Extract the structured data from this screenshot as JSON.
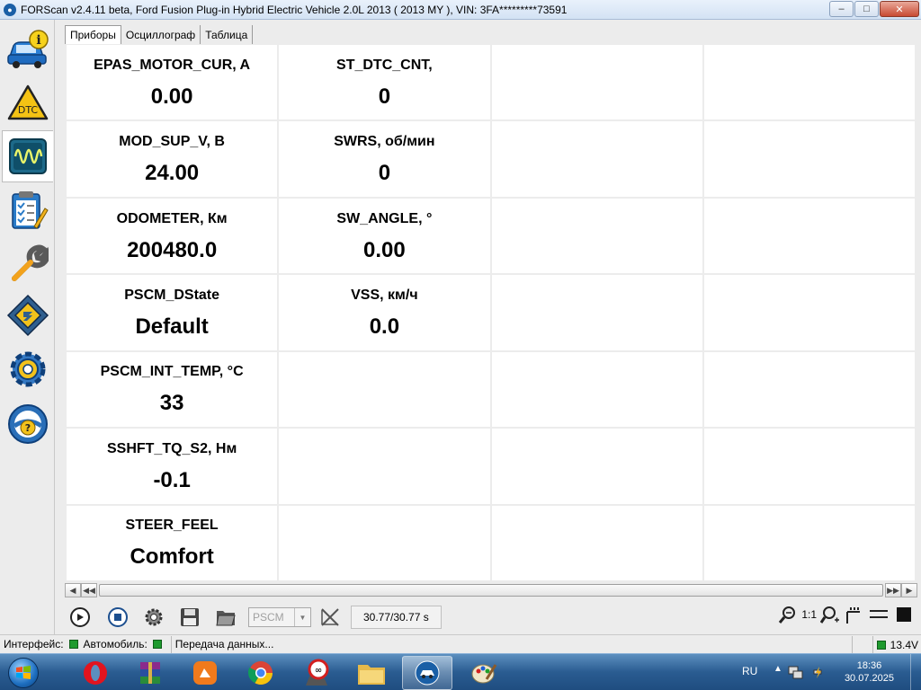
{
  "window": {
    "title": "FORScan v2.4.11 beta, Ford Fusion Plug-in Hybrid Electric Vehicle 2.0L 2013 ( 2013 MY ), VIN: 3FA*********73591",
    "minimize": "–",
    "maximize": "□",
    "close": "✕"
  },
  "sidebar": {
    "items": [
      {
        "name": "vehicle-info",
        "icon": "car-info-icon"
      },
      {
        "name": "dtc",
        "icon": "dtc-warning-icon",
        "label": "DTC"
      },
      {
        "name": "oscilloscope",
        "icon": "oscilloscope-icon"
      },
      {
        "name": "tests",
        "icon": "checklist-icon"
      },
      {
        "name": "service",
        "icon": "wrench-icon"
      },
      {
        "name": "configuration",
        "icon": "chip-icon"
      },
      {
        "name": "settings",
        "icon": "gear-icon"
      },
      {
        "name": "help",
        "icon": "help-icon",
        "label": "?"
      }
    ]
  },
  "tabs": [
    {
      "label": "Приборы",
      "active": true
    },
    {
      "label": "Осциллограф",
      "active": false
    },
    {
      "label": "Таблица",
      "active": false
    }
  ],
  "gauges": [
    {
      "name": "EPAS_MOTOR_CUR, A",
      "value": "0.00"
    },
    {
      "name": "ST_DTC_CNT,",
      "value": "0"
    },
    {
      "name": "MOD_SUP_V, В",
      "value": "24.00"
    },
    {
      "name": "SWRS, об/мин",
      "value": "0"
    },
    {
      "name": "ODOMETER, Км",
      "value": "200480.0"
    },
    {
      "name": "SW_ANGLE, °",
      "value": "0.00"
    },
    {
      "name": "PSCM_DState",
      "value": "Default"
    },
    {
      "name": "VSS, км/ч",
      "value": "0.0"
    },
    {
      "name": "PSCM_INT_TEMP, °C",
      "value": "33"
    },
    {
      "name": "SSHFT_TQ_S2, Нм",
      "value": "-0.1"
    },
    {
      "name": "STEER_FEEL",
      "value": "Comfort"
    }
  ],
  "toolbar": {
    "module_select": "PSCM",
    "time": "30.77/30.77 s",
    "zoom_ratio": "1:1"
  },
  "statusbar": {
    "interface_label": "Интерфейс:",
    "vehicle_label": "Автомобиль:",
    "status_text": "Передача данных...",
    "voltage": "13.4V",
    "ok_color": "#1e9a2e"
  },
  "taskbar": {
    "language": "RU",
    "time": "18:36",
    "date": "30.07.2025"
  }
}
